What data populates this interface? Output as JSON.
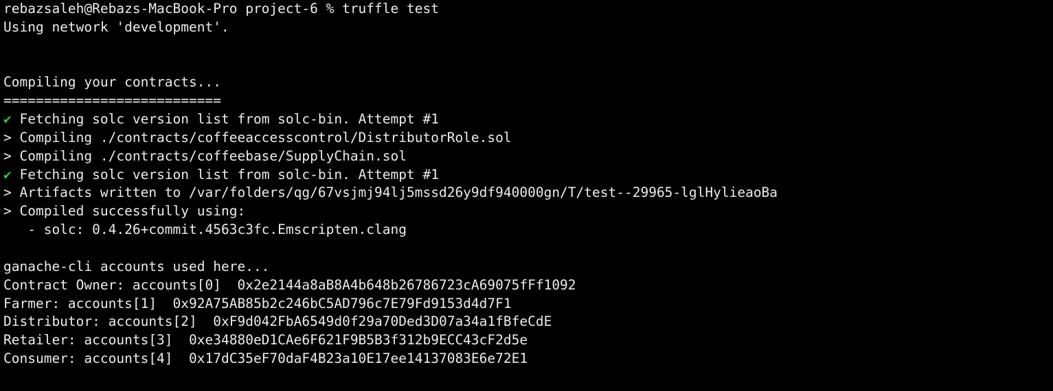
{
  "terminal": {
    "prompt": "rebazsaleh@Rebazs-MacBook-Pro project-6 % truffle test",
    "network": "Using network 'development'.",
    "compiling": "Compiling your contracts...",
    "separator": "===========================",
    "check_glyph": "✔",
    "fetch_1": " Fetching solc version list from solc-bin. Attempt #1",
    "compile_1": "> Compiling ./contracts/coffeeaccesscontrol/DistributorRole.sol",
    "compile_2": "> Compiling ./contracts/coffeebase/SupplyChain.sol",
    "fetch_2": " Fetching solc version list from solc-bin. Attempt #1",
    "artifacts": "> Artifacts written to /var/folders/qg/67vsjmj94lj5mssd26y9df940000gn/T/test--29965-lglHylieaoBa",
    "compiled": "> Compiled successfully using:",
    "solc": "   - solc: 0.4.26+commit.4563c3fc.Emscripten.clang",
    "accounts_header": "ganache-cli accounts used here...",
    "owner": "Contract Owner: accounts[0]  0x2e2144a8aB8A4b648b26786723cA69075fFf1092",
    "farmer": "Farmer: accounts[1]  0x92A75AB85b2c246bC5AD796c7E79Fd9153d4d7F1",
    "distributor": "Distributor: accounts[2]  0xF9d042FbA6549d0f29a70Ded3D07a34a1fBfeCdE",
    "retailer": "Retailer: accounts[3]  0xe34880eD1CAe6F621F9B5B3f312b9ECC43cF2d5e",
    "consumer": "Consumer: accounts[4]  0x17dC35eF70daF4B23a10E17ee14137083E6e72E1"
  },
  "colors": {
    "background": "#000000",
    "text": "#ececec",
    "check": "#3ec23e"
  }
}
